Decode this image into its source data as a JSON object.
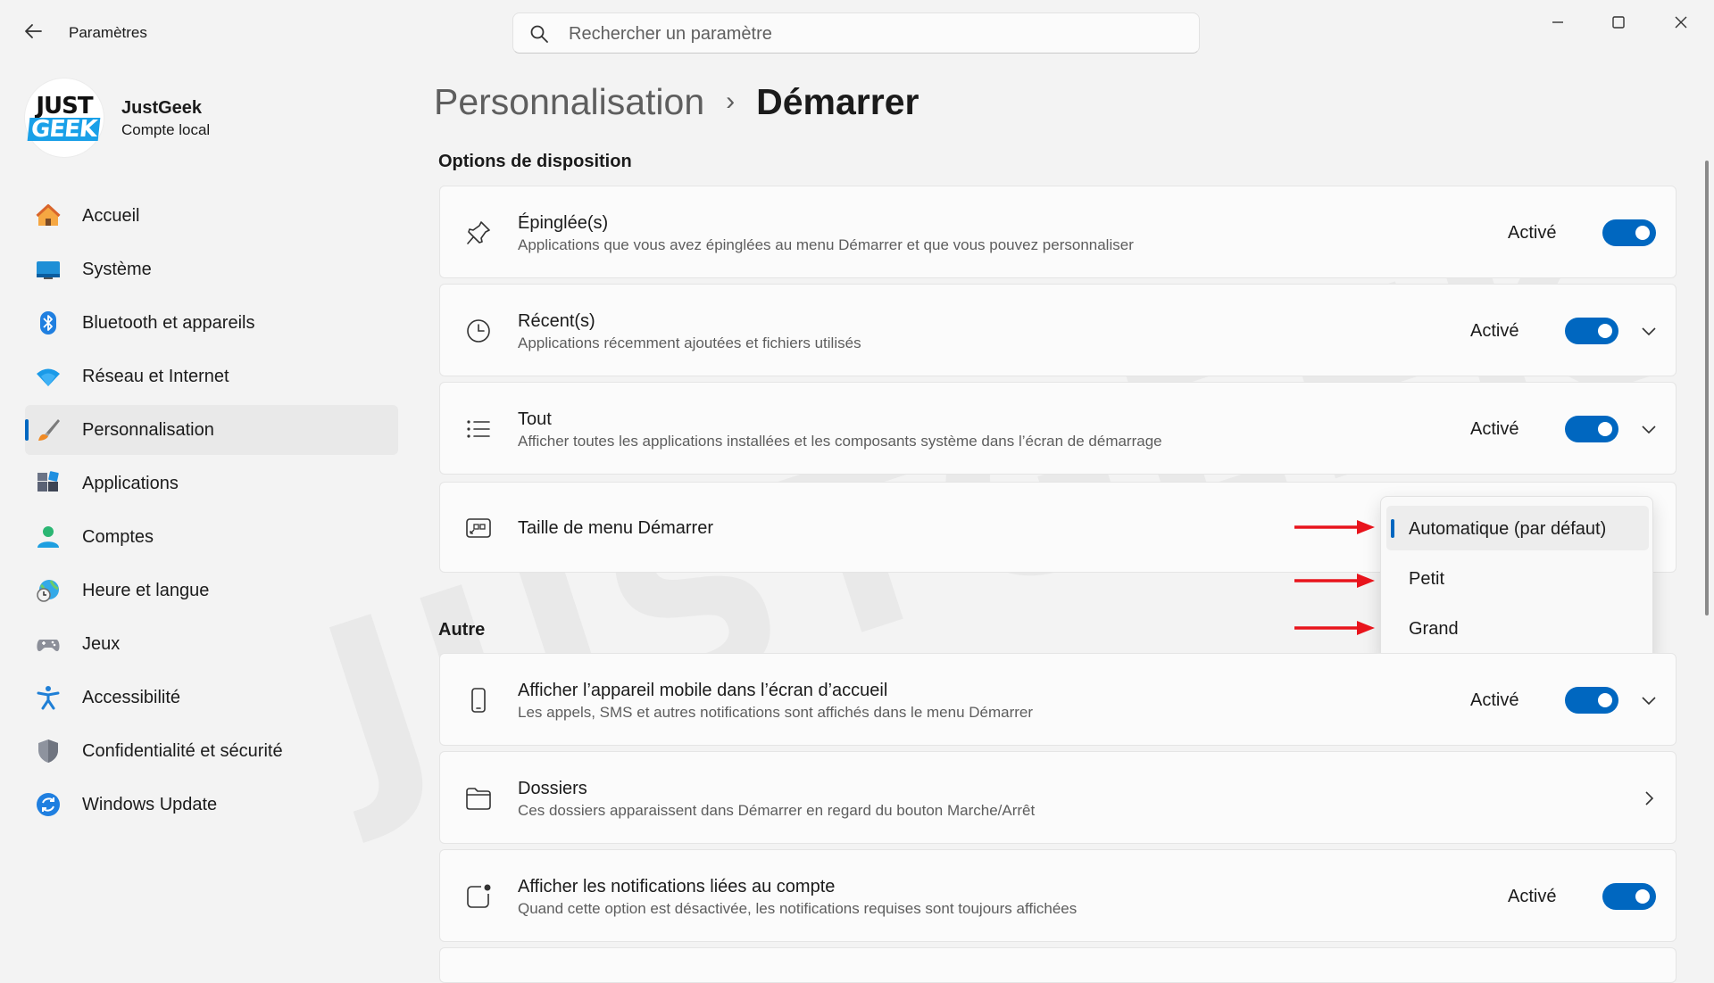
{
  "window": {
    "title": "Paramètres",
    "search_placeholder": "Rechercher un paramètre"
  },
  "profile": {
    "avatar_line1": "JUST",
    "avatar_line2": "GEEK",
    "name": "JustGeek",
    "account_type": "Compte local"
  },
  "nav": {
    "items": [
      {
        "label": "Accueil",
        "icon": "home-icon"
      },
      {
        "label": "Système",
        "icon": "monitor-icon"
      },
      {
        "label": "Bluetooth et appareils",
        "icon": "bluetooth-icon"
      },
      {
        "label": "Réseau et Internet",
        "icon": "wifi-icon"
      },
      {
        "label": "Personnalisation",
        "icon": "paintbrush-icon",
        "active": true
      },
      {
        "label": "Applications",
        "icon": "apps-icon"
      },
      {
        "label": "Comptes",
        "icon": "user-icon"
      },
      {
        "label": "Heure et langue",
        "icon": "globe-clock-icon"
      },
      {
        "label": "Jeux",
        "icon": "gamepad-icon"
      },
      {
        "label": "Accessibilité",
        "icon": "accessibility-icon"
      },
      {
        "label": "Confidentialité et sécurité",
        "icon": "shield-icon"
      },
      {
        "label": "Windows Update",
        "icon": "update-icon"
      }
    ]
  },
  "breadcrumb": {
    "parent": "Personnalisation",
    "separator": "›",
    "current": "Démarrer"
  },
  "sections": {
    "layout_title": "Options de disposition",
    "other_title": "Autre"
  },
  "cards": {
    "pinned": {
      "title": "Épinglée(s)",
      "subtitle": "Applications que vous avez épinglées au menu Démarrer et que vous pouvez personnaliser",
      "status": "Activé",
      "toggle_on": true
    },
    "recent": {
      "title": "Récent(s)",
      "subtitle": "Applications récemment ajoutées et fichiers utilisés",
      "status": "Activé",
      "toggle_on": true
    },
    "all": {
      "title": "Tout",
      "subtitle": "Afficher toutes les applications installées et les composants système dans l’écran de démarrage",
      "status": "Activé",
      "toggle_on": true
    },
    "menu_size": {
      "title": "Taille de menu Démarrer"
    },
    "mobile": {
      "title": "Afficher l’appareil mobile dans l’écran d’accueil",
      "subtitle": "Les appels, SMS et autres notifications sont affichés dans le menu Démarrer",
      "status": "Activé",
      "toggle_on": true
    },
    "folders": {
      "title": "Dossiers",
      "subtitle": "Ces dossiers apparaissent dans Démarrer en regard du bouton Marche/Arrêt"
    },
    "account_notifications": {
      "title": "Afficher les notifications liées au compte",
      "subtitle": "Quand cette option est désactivée, les notifications requises sont toujours affichées",
      "status": "Activé",
      "toggle_on": true
    }
  },
  "menu_size_dropdown": {
    "options": [
      "Automatique (par défaut)",
      "Petit",
      "Grand"
    ],
    "selected": "Automatique (par défaut)"
  },
  "watermark": "JUSTGEEK",
  "colors": {
    "accent": "#0067c0",
    "annotation_arrow": "#e8141c"
  }
}
